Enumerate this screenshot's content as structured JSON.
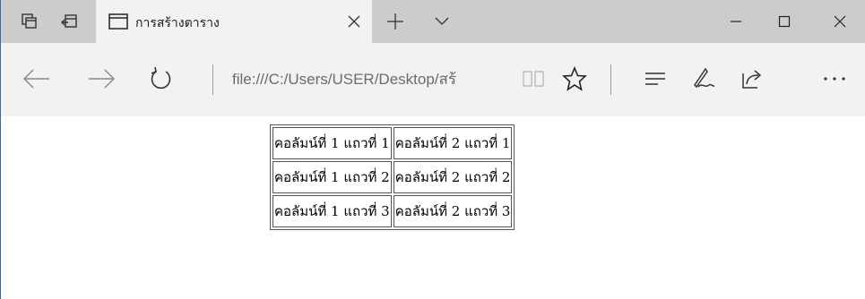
{
  "tab": {
    "title": "การสร้างตาราง"
  },
  "address_bar": {
    "url": "file:///C:/Users/USER/Desktop/สร้"
  },
  "table": {
    "rows": [
      [
        "คอลัมน์ที่ 1 แถวที่ 1",
        "คอลัมน์ที่ 2 แถวที่ 1"
      ],
      [
        "คอลัมน์ที่ 1 แถวที่ 2",
        "คอลัมน์ที่ 2 แถวที่ 2"
      ],
      [
        "คอลัมน์ที่ 1 แถวที่ 3",
        "คอลัมน์ที่ 2 แถวที่ 3"
      ]
    ]
  },
  "icons": {
    "titlebar": [
      "tab-manager-icon",
      "set-aside-tabs-icon"
    ],
    "tab": [
      "page-icon",
      "close-icon"
    ],
    "new_tab": "plus-icon",
    "tab_list": "chevron-down-icon",
    "window": [
      "minimize-icon",
      "maximize-icon",
      "close-window-icon"
    ],
    "navigation": [
      "back-arrow-icon",
      "forward-arrow-icon",
      "refresh-icon",
      "reading-view-icon",
      "favorite-star-icon",
      "hub-icon",
      "web-note-icon",
      "share-icon",
      "more-icon"
    ]
  },
  "colors": {
    "titlebar": "#cccccc",
    "active_tab": "#f2f2f2",
    "navbar": "#f2f2f2",
    "window_border": "#2b6fb4",
    "icon": "#333333",
    "address_text": "#6b6b6b"
  }
}
